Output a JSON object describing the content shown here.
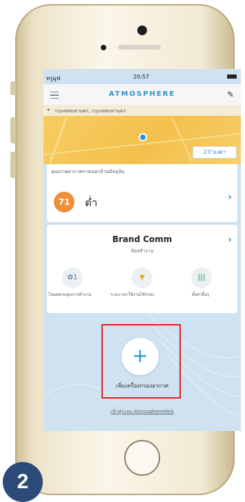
{
  "status_bar": {
    "carrier": "ทรูมูฟ",
    "time": "20:57"
  },
  "app": {
    "title": "ATMOSPHERE"
  },
  "location": {
    "text": "กรุงเทพมหานคร, กรุงเทพมหานคร"
  },
  "map": {
    "weather": "23°องศา"
  },
  "air_card": {
    "heading": "คุณภาพอากาศภายนอกบ้านปัจจุบัน",
    "aqi_value": "71",
    "aqi_label": "ต่ำ"
  },
  "device_card": {
    "name": "Brand Comm",
    "subtitle": "ห้องทำงาน",
    "controls": [
      {
        "value": "1",
        "label": "โหมดควบคุมการทำงาน"
      },
      {
        "value": "",
        "label": "ระยะเวลาใช้งานไส้กรอง"
      },
      {
        "value": "",
        "label": "ตั้งค่าอื่นๆ"
      }
    ]
  },
  "add_device": {
    "symbol": "+",
    "label": "เพิ่มเครื่องกรองอากาศ"
  },
  "web_link": "เข้าสู่ระบบ AtmosphereWeb",
  "step_number": "2"
}
